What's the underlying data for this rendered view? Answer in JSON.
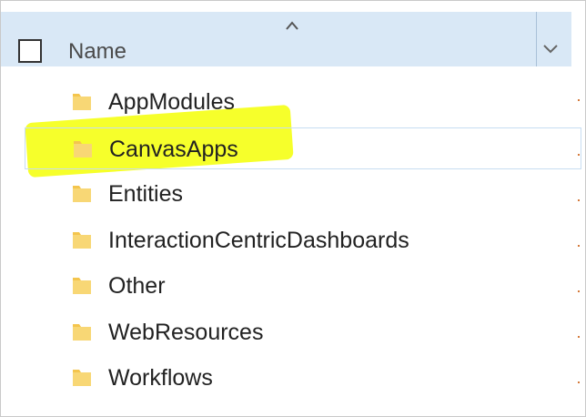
{
  "header": {
    "name_column_label": "Name",
    "sort_icon": "chevron-up-icon",
    "dropdown_icon": "chevron-down-icon"
  },
  "folders": [
    {
      "label": "AppModules",
      "icon": "folder-icon",
      "selected": false
    },
    {
      "label": "CanvasApps",
      "icon": "folder-icon",
      "selected": true
    },
    {
      "label": "Entities",
      "icon": "folder-icon",
      "selected": false
    },
    {
      "label": "InteractionCentricDashboards",
      "icon": "folder-icon",
      "selected": false
    },
    {
      "label": "Other",
      "icon": "folder-icon",
      "selected": false
    },
    {
      "label": "WebResources",
      "icon": "folder-icon",
      "selected": false
    },
    {
      "label": "Workflows",
      "icon": "folder-icon",
      "selected": false
    }
  ],
  "colors": {
    "header_bg": "#d9e8f6",
    "highlight": "#f5ff19",
    "folder": "#f4c54d",
    "selection_border": "#c7ddf1"
  }
}
